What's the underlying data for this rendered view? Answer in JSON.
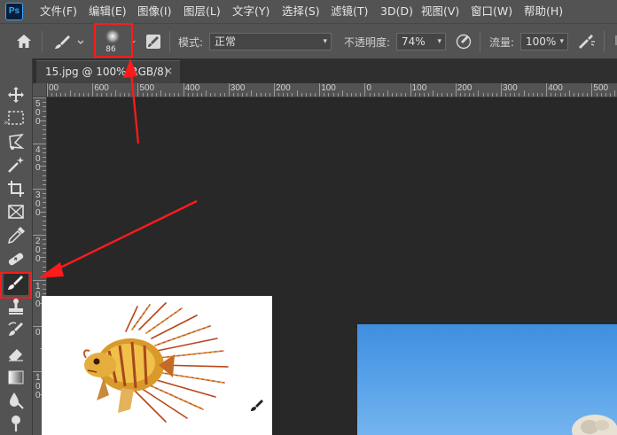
{
  "app": {
    "logo_text": "Ps",
    "menu": [
      "文件(F)",
      "编辑(E)",
      "图像(I)",
      "图层(L)",
      "文字(Y)",
      "选择(S)",
      "滤镜(T)",
      "3D(D)",
      "视图(V)",
      "窗口(W)",
      "帮助(H)"
    ]
  },
  "options_bar": {
    "brush_size": "86",
    "mode_label": "模式:",
    "mode_value": "正常",
    "opacity_label": "不透明度:",
    "opacity_value": "74%",
    "flow_label": "流量:",
    "flow_value": "100%"
  },
  "document": {
    "collapse_glyph": "»",
    "tab_label": "15.jpg @ 100%(RGB/8)",
    "close_glyph": "×"
  },
  "rulers": {
    "horizontal_labels": [
      "00",
      "600",
      "500",
      "400",
      "300",
      "200",
      "100",
      "0",
      "100",
      "200",
      "300",
      "400",
      "500"
    ],
    "vertical_groups": [
      [
        "5",
        "0",
        "0"
      ],
      [
        "4",
        "0",
        "0"
      ],
      [
        "3",
        "0",
        "0"
      ],
      [
        "2",
        "0",
        "0"
      ],
      [
        "1",
        "0",
        "0"
      ],
      [
        "0"
      ],
      [
        "1",
        "0",
        "0"
      ]
    ]
  },
  "colors": {
    "annotation_red": "#ff1b1b",
    "ui_panel": "#535353",
    "canvas_bg": "#282828",
    "accent_blue": "#31a8ff"
  },
  "highlights": {
    "toolbar_active_tool": "brush-tool",
    "options_active_control": "brush-preset-picker"
  }
}
